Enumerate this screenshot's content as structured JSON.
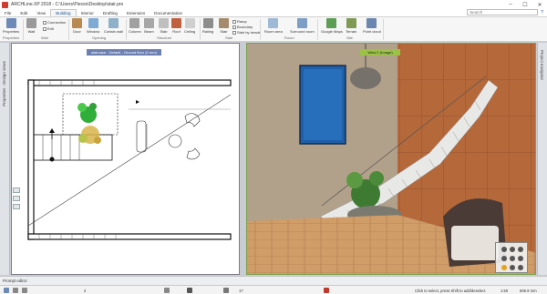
{
  "titlebar": {
    "title": "ARCHLine.XP 2018 - C:\\Users\\Pieces\\Desktop\\stair.pro",
    "controls": [
      "–",
      "☐",
      "✕"
    ]
  },
  "tabs": [
    "File",
    "Edit",
    "View",
    "Building",
    "Interior",
    "Drafting",
    "Extension",
    "Documentation"
  ],
  "active_tab": "Building",
  "search": {
    "placeholder": "Search"
  },
  "ribbon": {
    "buttons": [
      {
        "label": "Properties",
        "icon": "properties-icon",
        "color": "#6c89b8"
      },
      {
        "label": "Wall",
        "icon": "wall-icon",
        "color": "#9a9a9a"
      },
      {
        "label": "Door",
        "icon": "door-icon",
        "color": "#b98a54"
      },
      {
        "label": "Window",
        "icon": "window-icon",
        "color": "#7eaad3"
      },
      {
        "label": "Curtain wall",
        "icon": "curtain-wall-icon",
        "color": "#8eb1c9"
      },
      {
        "label": "Column",
        "icon": "column-icon",
        "color": "#a0a0a0"
      },
      {
        "label": "Beam",
        "icon": "beam-icon",
        "color": "#a7a7a7"
      },
      {
        "label": "Slab",
        "icon": "slab-icon",
        "color": "#bfbfbf"
      },
      {
        "label": "Roof",
        "icon": "roof-icon",
        "color": "#c0603e"
      },
      {
        "label": "Ceiling",
        "icon": "ceiling-icon",
        "color": "#cfcfcf"
      },
      {
        "label": "Railing",
        "icon": "railing-icon",
        "color": "#8d8d8d"
      },
      {
        "label": "Stair",
        "icon": "stair-icon",
        "color": "#a58a6b"
      },
      {
        "label": "Room area",
        "icon": "room-area-icon",
        "color": "#9db9d6"
      },
      {
        "label": "Surround room",
        "icon": "surround-room-icon",
        "color": "#7d9fc6"
      },
      {
        "label": "Google Maps",
        "icon": "google-maps-icon",
        "color": "#5c9e54"
      },
      {
        "label": "Terrain",
        "icon": "terrain-icon",
        "color": "#7f9a55"
      },
      {
        "label": "Point cloud",
        "icon": "point-cloud-icon",
        "color": "#6b87b0"
      }
    ],
    "small_items": {
      "connection": "Connection",
      "edit": "Edit",
      "ramp": "Ramp",
      "boundary": "Boundary",
      "stair_by_treads": "Stair by treads",
      "mode": "Wall"
    },
    "groups": [
      "Properties",
      "Wall",
      "Opening",
      "Structure",
      "Stair",
      "Room",
      "Site"
    ]
  },
  "panels": {
    "properties_label": "Properties - Design views",
    "project_navigator_label": "Project navigator",
    "plan_title": "staircase - Default - Ground floor (0 mm)",
    "render_title": "Wind 1 (Image)"
  },
  "status": {
    "prompt": "Prompt editor:",
    "hint": "Click to select, press Shift to add/deselect",
    "ratio": "1:50",
    "coord_x": "2",
    "zoom_label": "17",
    "zoom": "90%",
    "dim": "606.9 mm"
  },
  "bottom_icons": [
    "select-icon",
    "zoom-icon",
    "pan-icon",
    "layers-icon",
    "pen-icon",
    "grid-icon",
    "snap-icon"
  ],
  "colors": {
    "accent": "#1a4f9c",
    "plan_title_bg": "#6b7fb0",
    "render_title_bg": "#9bc247",
    "render_border": "#7aa24a"
  }
}
